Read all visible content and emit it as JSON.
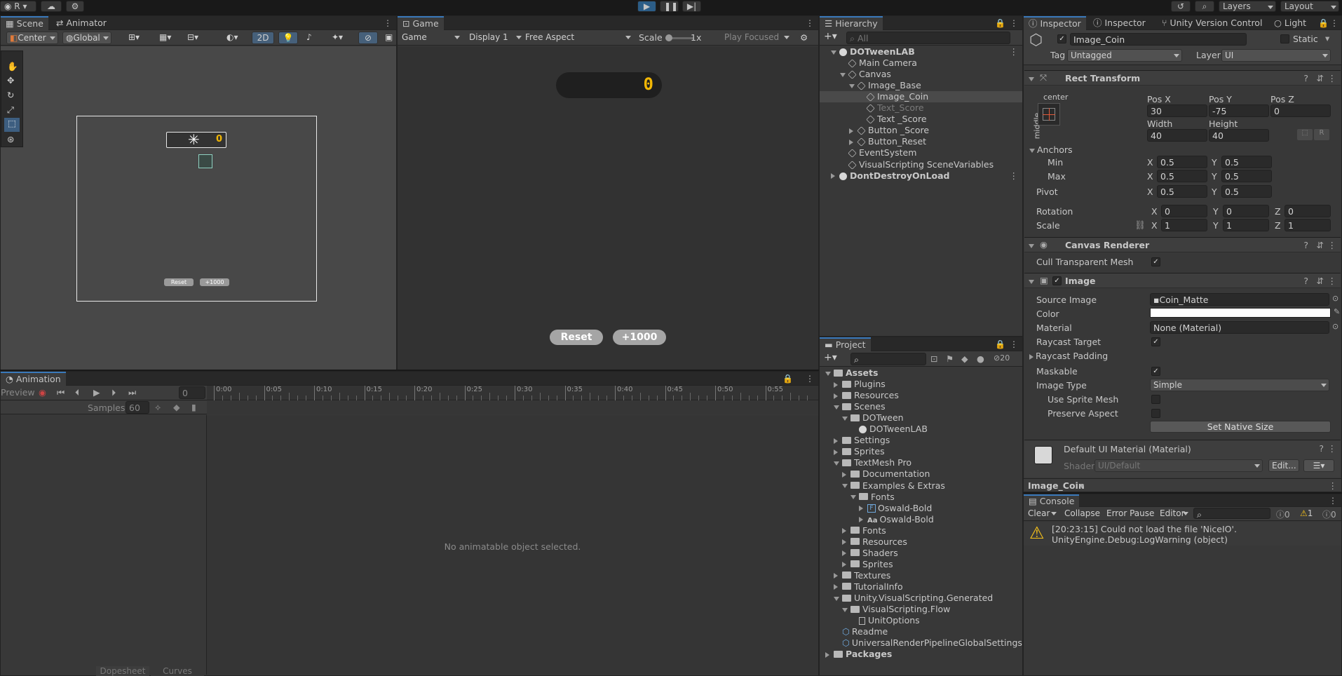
{
  "top_toolbar": {
    "account": "R",
    "layers": "Layers",
    "layout": "Layout"
  },
  "scene_panel": {
    "tabs": [
      "Scene",
      "Animator"
    ],
    "pivot": "Center",
    "space": "Global",
    "mode_2d": "2D",
    "game_ui": {
      "score": "0",
      "reset": "Reset",
      "plus": "+1000"
    }
  },
  "game_panel": {
    "tab": "Game",
    "display_mode": "Game",
    "display": "Display 1",
    "aspect": "Free Aspect",
    "scale_label": "Scale",
    "scale_value": "1x",
    "play_mode": "Play Focused",
    "score": "0",
    "reset_button": "Reset",
    "plus_button": "+1000"
  },
  "animation_panel": {
    "tab": "Animation",
    "preview": "Preview",
    "frame": "0",
    "samples_label": "Samples",
    "samples": "60",
    "ticks": [
      "0:00",
      "0:05",
      "0:10",
      "0:15",
      "0:20",
      "0:25",
      "0:30",
      "0:35",
      "0:40",
      "0:45",
      "0:50",
      "0:55"
    ],
    "empty_message": "No animatable object selected.",
    "dopesheet": "Dopesheet",
    "curves": "Curves"
  },
  "hierarchy": {
    "tab": "Hierarchy",
    "search_placeholder": "All",
    "items": [
      {
        "label": "DOTweenLAB",
        "icon": "unity-scene-icon"
      },
      {
        "label": "Main Camera",
        "icon": "gameobject-icon"
      },
      {
        "label": "Canvas",
        "icon": "gameobject-icon"
      },
      {
        "label": "Image_Base",
        "icon": "gameobject-icon"
      },
      {
        "label": "Image_Coin",
        "icon": "gameobject-icon"
      },
      {
        "label": "Text_Score",
        "icon": "gameobject-icon"
      },
      {
        "label": "Text _Score",
        "icon": "gameobject-icon"
      },
      {
        "label": "Button _Score",
        "icon": "gameobject-icon"
      },
      {
        "label": "Button_Reset",
        "icon": "gameobject-icon"
      },
      {
        "label": "EventSystem",
        "icon": "gameobject-icon"
      },
      {
        "label": "VisualScripting SceneVariables",
        "icon": "gameobject-icon"
      },
      {
        "label": "DontDestroyOnLoad",
        "icon": "unity-scene-icon"
      }
    ]
  },
  "project": {
    "tab": "Project",
    "hidden_count": "20",
    "items": [
      {
        "label": "Assets"
      },
      {
        "label": "Plugins"
      },
      {
        "label": "Resources"
      },
      {
        "label": "Scenes"
      },
      {
        "label": "DOTween"
      },
      {
        "label": "DOTweenLAB"
      },
      {
        "label": "Settings"
      },
      {
        "label": "Sprites"
      },
      {
        "label": "TextMesh Pro"
      },
      {
        "label": "Documentation"
      },
      {
        "label": "Examples & Extras"
      },
      {
        "label": "Fonts"
      },
      {
        "label": "Oswald-Bold"
      },
      {
        "label": "Oswald-Bold"
      },
      {
        "label": "Fonts"
      },
      {
        "label": "Resources"
      },
      {
        "label": "Shaders"
      },
      {
        "label": "Sprites"
      },
      {
        "label": "Textures"
      },
      {
        "label": "TutorialInfo"
      },
      {
        "label": "Unity.VisualScripting.Generated"
      },
      {
        "label": "VisualScripting.Flow"
      },
      {
        "label": "UnitOptions"
      },
      {
        "label": "Readme"
      },
      {
        "label": "UniversalRenderPipelineGlobalSettings"
      },
      {
        "label": "Packages"
      }
    ]
  },
  "inspector": {
    "tabs": [
      "Inspector",
      "Inspector",
      "Unity Version Control",
      "Light"
    ],
    "object_name": "Image_Coin",
    "static_label": "Static",
    "tag_label": "Tag",
    "tag": "Untagged",
    "layer_label": "Layer",
    "layer": "UI",
    "rect_transform": {
      "title": "Rect Transform",
      "anchor_h": "center",
      "anchor_v": "middle",
      "pos_x_label": "Pos X",
      "pos_y_label": "Pos Y",
      "pos_z_label": "Pos Z",
      "pos_x": "30",
      "pos_y": "-75",
      "pos_z": "0",
      "width_label": "Width",
      "height_label": "Height",
      "width": "40",
      "height": "40",
      "anchors": "Anchors",
      "min": "Min",
      "max": "Max",
      "min_x": "0.5",
      "min_y": "0.5",
      "max_x": "0.5",
      "max_y": "0.5",
      "pivot": "Pivot",
      "pivot_x": "0.5",
      "pivot_y": "0.5",
      "rotation": "Rotation",
      "rot_x": "0",
      "rot_y": "0",
      "rot_z": "0",
      "scale": "Scale",
      "scale_x": "1",
      "scale_y": "1",
      "scale_z": "1",
      "x": "X",
      "y": "Y",
      "z": "Z",
      "r": "R"
    },
    "canvas_renderer": {
      "title": "Canvas Renderer",
      "cull": "Cull Transparent Mesh"
    },
    "image": {
      "title": "Image",
      "source_label": "Source Image",
      "source": "Coin_Matte",
      "color_label": "Color",
      "material_label": "Material",
      "material": "None (Material)",
      "raycast_target": "Raycast Target",
      "raycast_padding": "Raycast Padding",
      "maskable": "Maskable",
      "image_type_label": "Image Type",
      "image_type": "Simple",
      "use_sprite_mesh": "Use Sprite Mesh",
      "preserve_aspect": "Preserve Aspect",
      "set_native": "Set Native Size"
    },
    "material": {
      "title": "Default UI Material (Material)",
      "shader_label": "Shader",
      "shader": "UI/Default",
      "edit": "Edit..."
    },
    "preview_name": "Image_Coin"
  },
  "console": {
    "tab": "Console",
    "clear": "Clear",
    "collapse": "Collapse",
    "error_pause": "Error Pause",
    "editor": "Editor",
    "counts": {
      "log": "0",
      "warn": "1",
      "error": "0"
    },
    "message1": "[20:23:15] Could not load the file 'NiceIO'.",
    "message2": "UnityEngine.Debug:LogWarning (object)"
  },
  "colors": {
    "accent": "#3a79bb",
    "score_yellow": "#f2b705",
    "warning": "#f7c21a"
  }
}
